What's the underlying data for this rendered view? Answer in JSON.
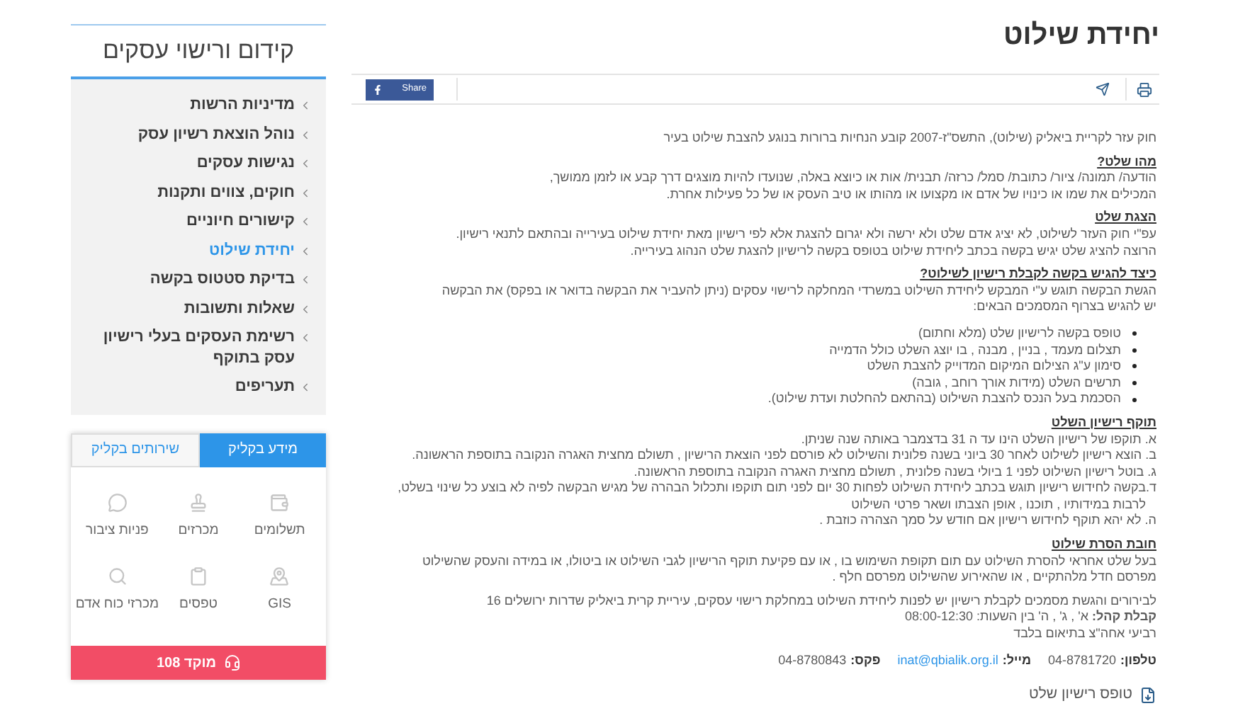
{
  "sidebar": {
    "title": "קידום ורישוי עסקים",
    "items": [
      {
        "label": "מדיניות הרשות",
        "selected": false
      },
      {
        "label": "נוהל הוצאת רשיון עסק",
        "selected": false
      },
      {
        "label": "נגישות עסקים",
        "selected": false
      },
      {
        "label": "חוקים, צווים ותקנות",
        "selected": false
      },
      {
        "label": "קישורים חיוניים",
        "selected": false
      },
      {
        "label": "יחידת שילוט",
        "selected": true
      },
      {
        "label": "בדיקת סטטוס בקשה",
        "selected": false
      },
      {
        "label": "שאלות ותשובות",
        "selected": false
      },
      {
        "label": "רשימת העסקים בעלי רישיון עסק בתוקף",
        "selected": false
      },
      {
        "label": "תעריפים",
        "selected": false
      }
    ]
  },
  "quick": {
    "tabs": [
      {
        "label": "מידע בקליק",
        "selected": true
      },
      {
        "label": "שירותים בקליק",
        "selected": false
      }
    ],
    "tiles": [
      {
        "label": "תשלומים",
        "kind": "wallet"
      },
      {
        "label": "מכרזים",
        "kind": "stamp"
      },
      {
        "label": "פניות ציבור",
        "kind": "chat"
      },
      {
        "label": "GIS",
        "kind": "pin"
      },
      {
        "label": "טפסים",
        "kind": "clipboard"
      },
      {
        "label": "מכרזי כוח אדם",
        "kind": "search"
      }
    ],
    "hotline": "מוקד 108"
  },
  "page": {
    "title": "יחידת שילוט",
    "share": "Share",
    "intro": "חוק עזר לקריית ביאליק (שילוט), התשס\"ז-2007  קובע הנחיות ברורות בנוגע להצבת שילוט בעיר",
    "sections": [
      {
        "heading": "מהו שלט?",
        "lines": [
          "הודעה/ תמונה/ ציור/ כתובת/ סמל/ כרזה/ תבנית/ אות או כיוצא באלה, שנועדו להיות מוצגים דרך קבע או לזמן ממושך,",
          "המכילים את שמו או כינויו של אדם או מקצועו או מהותו או טיב העסק או של כל פעילות אחרת."
        ]
      },
      {
        "heading": "הצגת שלט",
        "lines": [
          "עפ\"י חוק העזר לשילוט, לא יציג אדם שלט ולא ירשה ולא יגרום להצגת אלא לפי רישיון מאת יחידת שילוט בעירייה ובהתאם לתנאי רישיון.",
          "הרוצה להציג שלט יגיש בקשה בכתב ליחידת שילוט בטופס בקשה לרישיון להצגת שלט הנהוג בעירייה."
        ]
      },
      {
        "heading": "כיצד להגיש בקשה לקבלת רישיון לשילוט?",
        "lines": [
          "הגשת הבקשה תוגש ע\"י המבקש ליחידת השילוט במשרדי המחלקה לרישוי עסקים (ניתן להעביר את הבקשה בדואר או בפקס) את הבקשה",
          "יש להגיש בצרוף המסמכים הבאים:"
        ],
        "bullets": [
          "טופס בקשה לרישיון שלט (מלא וחתום)",
          "תצלום מעמד , בניין , מבנה , בו יוצג השלט כולל הדמייה",
          "סימון ע\"ג הצילום המיקום המדוייק להצבת השלט",
          "תרשים השלט (מידות אורך רוחב , גובה)",
          "הסכמת בעל הנכס להצבת השילוט (בהתאם להחלטת ועדת שילוט)."
        ]
      },
      {
        "heading": "תוקף רישיון השלט",
        "lines": [
          "א. תוקפו של רישיון השלט הינו עד ה 31 בדצמבר באותה שנה שניתן.",
          "ב. הוצא רישיון לשילוט לאחר 30 ביוני בשנה פלונית והשילוט לא פורסם לפני הוצאת הרישיון , תשולם מחצית האגרה הנקובה בתוספת הראשונה.",
          "ג. בוטל רישיון השילוט לפני 1 ביולי בשנה פלונית , תשולם מחצית האגרה הנקובה בתוספת הראשונה.",
          "ד.בקשה לחידוש רישיון תוגש בכתב ליחידת השילוט לפחות 30 יום לפני תום תוקפו ותכלול הבהרה של מגיש הבקשה לפיה לא בוצע כל שינוי בשלט,",
          "   לרבות במידותיו , תוכנו , אופן הצבתו ושאר פרטי השילוט",
          "ה. לא יהא תוקף לחידוש רישיון אם חודש על סמך הצהרה כוזבת ."
        ]
      },
      {
        "heading": "חובת הסרת שילוט",
        "lines": [
          "בעל שלט אחראי להסרת השילוט עם תום תקופת השימוש בו , או עם פקיעת תוקף הרישיון לגבי השילוט או ביטולו, או במידה והעסק שהשילוט",
          "מפרסם חדל מלהתקיים , או שהאירוע שהשילוט מפרסם חלף ."
        ]
      }
    ],
    "info": [
      "לבירורים והגשת מסמכים לקבלת רישיון יש לפנות ליחידת השילוט במחלקת רישוי עסקים, עיריית קרית ביאליק שדרות ירושלים 16",
      "**קבלת קהל:** א' , ג' , ה' בין השעות: 08:00-12:30",
      "רביעי אחה\"צ בתיאום בלבד"
    ],
    "contacts": [
      {
        "label": "טלפון:",
        "value": "04-8781720",
        "kind": "text"
      },
      {
        "label": "מייל:",
        "value": "inat@qbialik.org.il",
        "kind": "link"
      },
      {
        "label": "פקס:",
        "value": "04-8780843",
        "kind": "text"
      }
    ],
    "form_link": "טופס רישיון שלט"
  }
}
